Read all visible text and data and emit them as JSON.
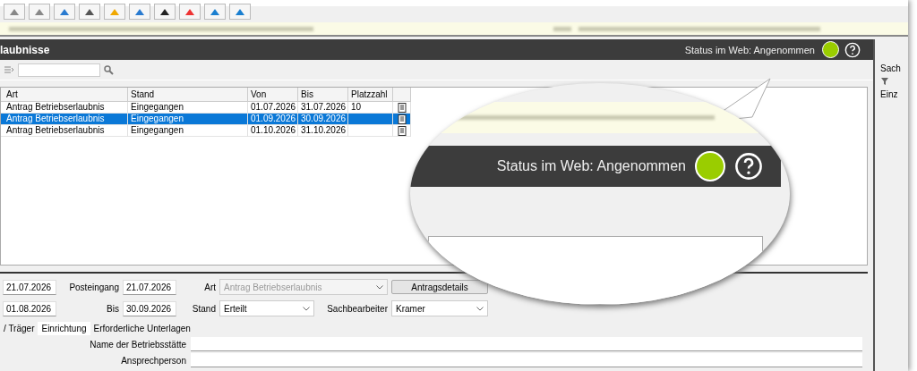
{
  "panel": {
    "title": "laubnisse",
    "status": "Status im Web: Angenommen"
  },
  "table": {
    "columns": [
      "Art",
      "Stand",
      "Von",
      "Bis",
      "Platzzahl"
    ],
    "rows": [
      {
        "cells": [
          "Antrag Betriebserlaubnis",
          "Eingegangen",
          "01.07.2026",
          "31.07.2026",
          "10"
        ],
        "selected": false
      },
      {
        "cells": [
          "Antrag Betriebserlaubnis",
          "Eingegangen",
          "01.09.2026",
          "30.09.2026",
          ""
        ],
        "selected": true
      },
      {
        "cells": [
          "Antrag Betriebserlaubnis",
          "Eingegangen",
          "01.10.2026",
          "31.10.2026",
          ""
        ],
        "selected": false
      }
    ]
  },
  "form": {
    "row_1": {
      "date": "21.07.2026",
      "posteingang_label": "Posteingang",
      "posteingang": "21.07.2026",
      "art_label": "Art",
      "art": {
        "value": "Antrag Betriebserlaubnis",
        "disabled": true
      },
      "button": "Antragsdetails"
    },
    "row_2": {
      "date": "01.08.2026",
      "bis_label": "Bis",
      "bis": "30.09.2026",
      "stand_label": "Stand",
      "stand": {
        "value": "Erteilt",
        "disabled": false
      },
      "sachbearbeiter_label": "Sachbearbeiter",
      "sachbearbeiter": {
        "value": "Kramer",
        "disabled": false
      }
    }
  },
  "tabs": [
    {
      "label": "/ Träger",
      "selected": false
    },
    {
      "label": "Einrichtung",
      "selected": true
    },
    {
      "label": "Erforderliche Unterlagen",
      "selected": false
    }
  ],
  "fields": [
    {
      "label": "Name der Betriebsstätte"
    },
    {
      "label": "Ansprechperson"
    }
  ],
  "side_panel": {
    "title": "Sach",
    "list_header": "Einz"
  },
  "magnifier": {
    "status": "Status im Web: Angenommen"
  }
}
